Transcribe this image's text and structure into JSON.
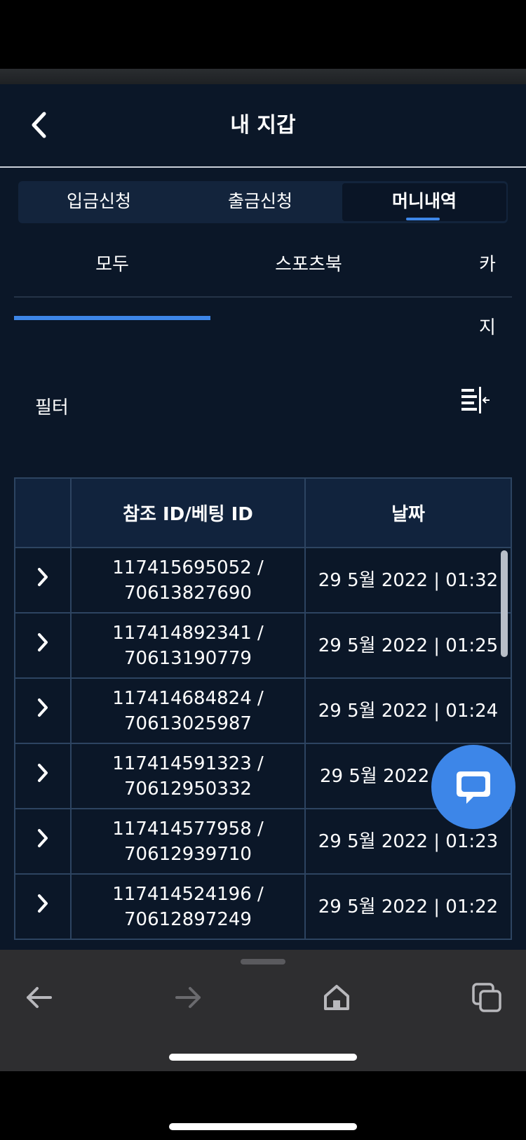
{
  "header": {
    "title": "내 지갑"
  },
  "tabs": [
    {
      "label": "입금신청"
    },
    {
      "label": "출금신청"
    },
    {
      "label": "머니내역"
    }
  ],
  "subtabs": [
    {
      "label": "모두"
    },
    {
      "label": "스포츠북"
    },
    {
      "label": "카지"
    }
  ],
  "filter": {
    "label": "필터"
  },
  "table": {
    "headers": {
      "ref": "참조 ID/베팅 ID",
      "date": "날짜"
    },
    "rows": [
      {
        "ref_line1": "117415695052 /",
        "ref_line2": "70613827690",
        "date": "29 5월 2022 | 01:32"
      },
      {
        "ref_line1": "117414892341 /",
        "ref_line2": "70613190779",
        "date": "29 5월 2022 | 01:25"
      },
      {
        "ref_line1": "117414684824 /",
        "ref_line2": "70613025987",
        "date": "29 5월 2022 | 01:24"
      },
      {
        "ref_line1": "117414591323 /",
        "ref_line2": "70612950332",
        "date": "29 5월 2022"
      },
      {
        "ref_line1": "117414577958 /",
        "ref_line2": "70612939710",
        "date": "29 5월 2022 | 01:23"
      },
      {
        "ref_line1": "117414524196 /",
        "ref_line2": "70612897249",
        "date": "29 5월 2022 | 01:22"
      }
    ]
  },
  "colors": {
    "background": "#0b1728",
    "accent": "#3d86e8",
    "header_bg": "#11233d"
  },
  "icons": {
    "back": "chevron-left-icon",
    "filter": "filter-collapse-icon",
    "row_expand": "chevron-right-icon",
    "chat": "chat-bubble-icon"
  }
}
